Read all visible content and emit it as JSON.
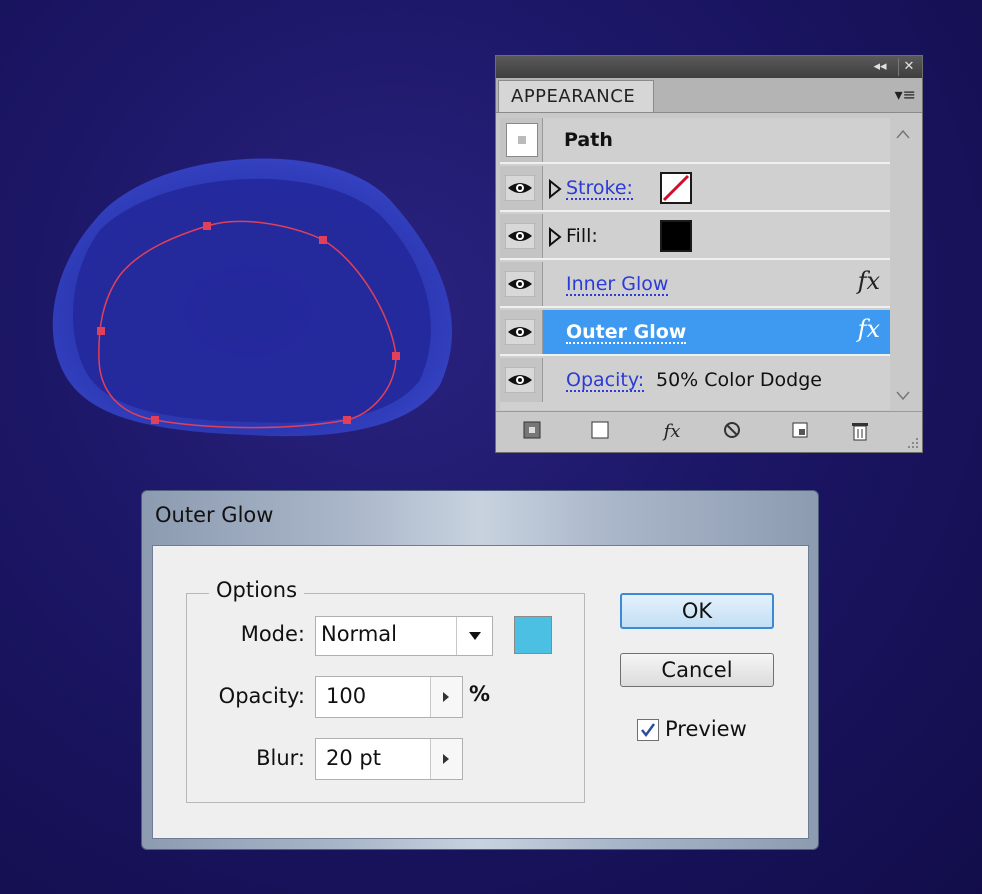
{
  "appearance_panel": {
    "collapse_glyph": "◂◂",
    "close_glyph": "✕",
    "tab_label": "APPEARANCE",
    "menu_glyph": "▾≡",
    "path_label": "Path",
    "stroke_label": "Stroke:",
    "fill_label": "Fill:",
    "inner_glow_label": "Inner Glow",
    "outer_glow_label": "Outer Glow",
    "opacity_label": "Opacity:",
    "opacity_value": "50% Color Dodge",
    "fx_glyph": "fx",
    "selected_row": "Outer Glow",
    "colors": {
      "selected": "#3d9af0",
      "link": "#2a3bd6",
      "fill_swatch": "#000000"
    }
  },
  "outer_glow_dialog": {
    "title": "Outer Glow",
    "group_label": "Options",
    "mode_label": "Mode:",
    "mode_value": "Normal",
    "opacity_label": "Opacity:",
    "opacity_value": "100",
    "opacity_unit": "%",
    "blur_label": "Blur:",
    "blur_value": "20 pt",
    "glow_color": "#4cc0e3",
    "ok_label": "OK",
    "cancel_label": "Cancel",
    "preview_label": "Preview",
    "preview_checked": true
  }
}
